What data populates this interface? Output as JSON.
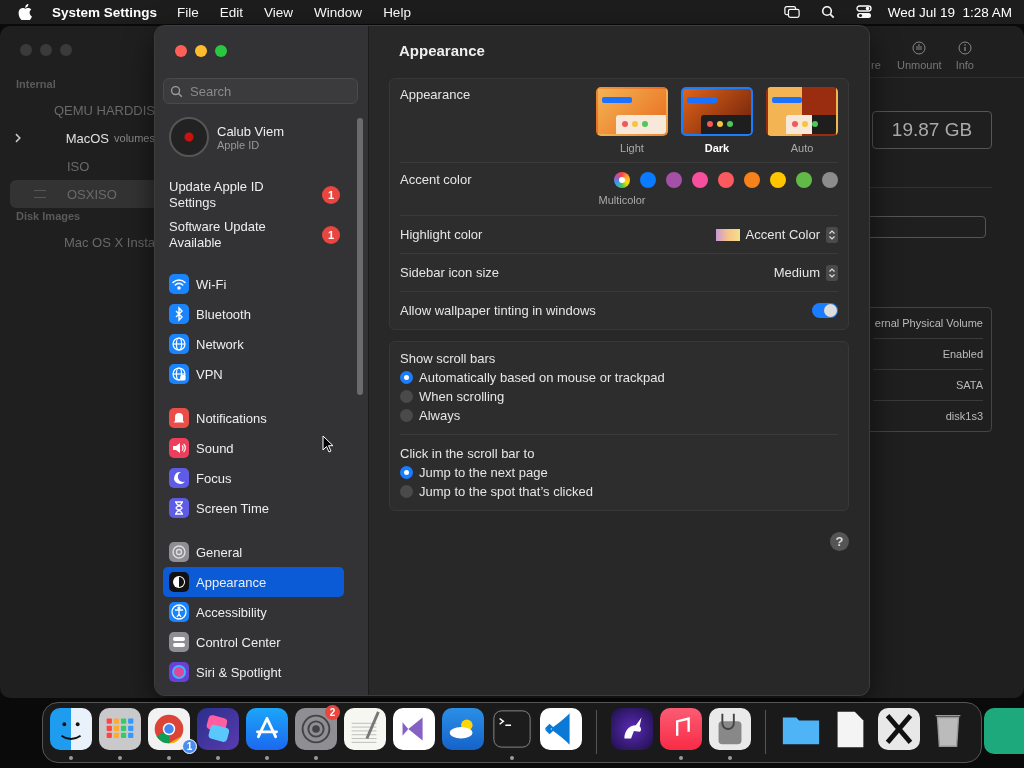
{
  "menu_bar": {
    "app_name": "System Settings",
    "menus": [
      "File",
      "Edit",
      "View",
      "Window",
      "Help"
    ],
    "clock": "Wed Jul 19  1:28 AM"
  },
  "disk_utility": {
    "sections": [
      {
        "title": "Internal",
        "items": [
          {
            "label": "QEMU HARDDIS",
            "kind": "disk",
            "selected": false
          },
          {
            "label": "MacOS",
            "note": "volumes",
            "kind": "container",
            "selected": false
          },
          {
            "label": "ISO",
            "kind": "disk",
            "selected": false
          },
          {
            "label": "OSXISO",
            "kind": "volume",
            "selected": true
          }
        ]
      },
      {
        "title": "Disk Images",
        "items": [
          {
            "label": "Mac OS X Insta",
            "kind": "disk",
            "selected": false
          }
        ]
      }
    ],
    "toolbar": [
      {
        "label": "re",
        "kind": "blank"
      },
      {
        "label": "Unmount",
        "kind": "eject"
      },
      {
        "label": "Info",
        "kind": "info"
      }
    ],
    "capacity": "19.87 GB",
    "info_rows": [
      "ernal Physical Volume",
      "Enabled",
      "SATA",
      "disk1s3"
    ]
  },
  "settings": {
    "search": {
      "placeholder": "Search"
    },
    "account": {
      "name": "Calub Viem",
      "subtitle": "Apple ID"
    },
    "alerts": [
      {
        "label": "Update Apple ID Settings",
        "badge": "1"
      },
      {
        "label": "Software Update Available",
        "badge": "1"
      }
    ],
    "groups": [
      [
        {
          "label": "Wi-Fi",
          "kind": "wifi",
          "selected": false
        },
        {
          "label": "Bluetooth",
          "kind": "bluetooth",
          "selected": false
        },
        {
          "label": "Network",
          "kind": "network",
          "selected": false
        },
        {
          "label": "VPN",
          "kind": "vpn",
          "selected": false
        }
      ],
      [
        {
          "label": "Notifications",
          "kind": "notifications",
          "selected": false
        },
        {
          "label": "Sound",
          "kind": "sound",
          "selected": false
        },
        {
          "label": "Focus",
          "kind": "focus",
          "selected": false
        },
        {
          "label": "Screen Time",
          "kind": "screentime",
          "selected": false
        }
      ],
      [
        {
          "label": "General",
          "kind": "general",
          "selected": false
        },
        {
          "label": "Appearance",
          "kind": "appearance",
          "selected": true
        },
        {
          "label": "Accessibility",
          "kind": "accessibility",
          "selected": false
        },
        {
          "label": "Control Center",
          "kind": "controlcenter",
          "selected": false
        },
        {
          "label": "Siri & Spotlight",
          "kind": "siri",
          "selected": false
        }
      ]
    ],
    "page_title": "Appearance",
    "appearance": {
      "label": "Appearance",
      "options": [
        {
          "label": "Light",
          "kind": "light",
          "selected": false
        },
        {
          "label": "Dark",
          "kind": "dark",
          "selected": true
        },
        {
          "label": "Auto",
          "kind": "auto",
          "selected": false
        }
      ]
    },
    "accent": {
      "label": "Accent color",
      "colors": [
        {
          "kind": "multi",
          "label": "Multicolor",
          "selected": true
        },
        {
          "kind": "solid",
          "color": "#0a7aff",
          "selected": false
        },
        {
          "kind": "solid",
          "color": "#a550a7",
          "selected": false
        },
        {
          "kind": "solid",
          "color": "#f74f9e",
          "selected": false
        },
        {
          "kind": "solid",
          "color": "#fc5a5f",
          "selected": false
        },
        {
          "kind": "solid",
          "color": "#f7821b",
          "selected": false
        },
        {
          "kind": "solid",
          "color": "#ffc600",
          "selected": false
        },
        {
          "kind": "solid",
          "color": "#62ba46",
          "selected": false
        },
        {
          "kind": "solid",
          "color": "#8c8c8c",
          "selected": false
        }
      ]
    },
    "highlight": {
      "label": "Highlight color",
      "value": "Accent Color"
    },
    "icon_size": {
      "label": "Sidebar icon size",
      "value": "Medium"
    },
    "tinting": {
      "label": "Allow wallpaper tinting in windows",
      "on": true
    },
    "radio_groups": [
      {
        "label": "Show scroll bars",
        "options": [
          {
            "label": "Automatically based on mouse or trackpad",
            "selected": true
          },
          {
            "label": "When scrolling",
            "selected": false
          },
          {
            "label": "Always",
            "selected": false
          }
        ]
      },
      {
        "label": "Click in the scroll bar to",
        "options": [
          {
            "label": "Jump to the next page",
            "selected": true
          },
          {
            "label": "Jump to the spot that’s clicked",
            "selected": false
          }
        ]
      }
    ],
    "help": "?"
  },
  "dock": [
    {
      "kind": "finder",
      "running": true
    },
    {
      "kind": "launchpad",
      "running": true
    },
    {
      "kind": "chrome",
      "running": true,
      "badge": {
        "text": "1",
        "kind": "progress"
      }
    },
    {
      "kind": "shortcuts",
      "running": true
    },
    {
      "kind": "appstore",
      "running": true
    },
    {
      "kind": "settings",
      "running": true,
      "badge": {
        "text": "2",
        "kind": "alert"
      }
    },
    {
      "kind": "textedit",
      "running": false
    },
    {
      "kind": "visualstudio",
      "running": false
    },
    {
      "kind": "weather",
      "running": false
    },
    {
      "kind": "terminal",
      "running": true
    },
    {
      "kind": "vscode",
      "running": false
    },
    {
      "kind": "divider"
    },
    {
      "kind": "unicorn",
      "running": false
    },
    {
      "kind": "music",
      "running": true
    },
    {
      "kind": "diskutility",
      "running": true
    },
    {
      "kind": "divider"
    },
    {
      "kind": "folder",
      "running": false
    },
    {
      "kind": "file",
      "running": false
    },
    {
      "kind": "x11",
      "running": false
    },
    {
      "kind": "trash",
      "running": false
    }
  ]
}
